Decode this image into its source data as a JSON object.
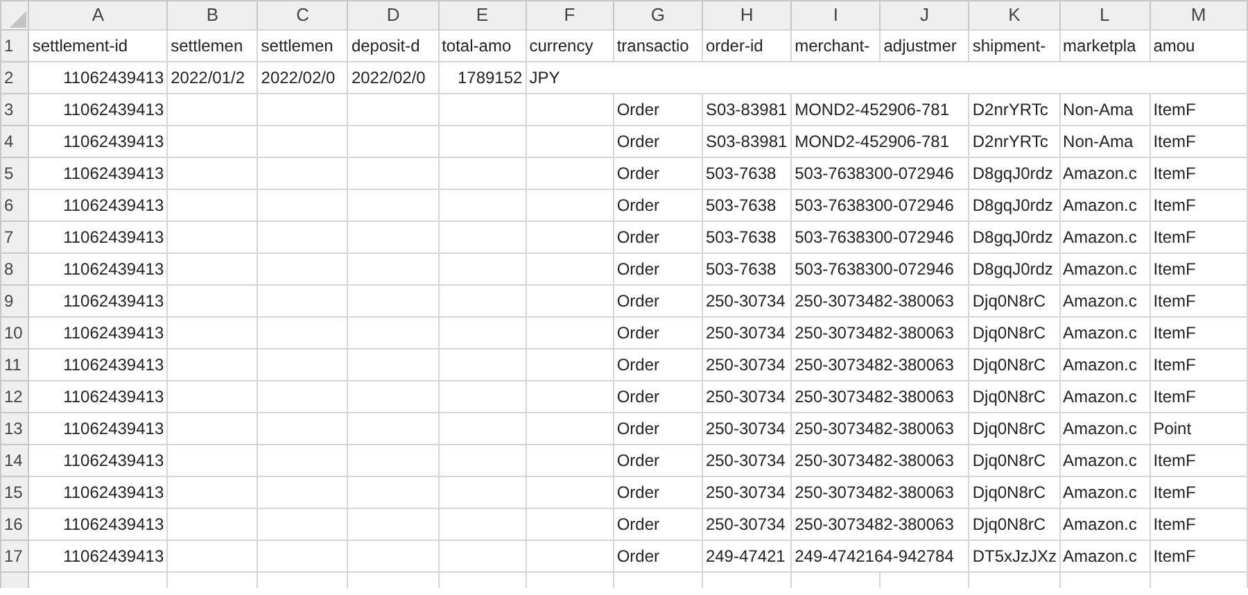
{
  "columns": [
    "A",
    "B",
    "C",
    "D",
    "E",
    "F",
    "G",
    "H",
    "I",
    "J",
    "K",
    "L",
    "M"
  ],
  "rows": [
    {
      "number": "1",
      "cells": [
        "settlement-id",
        "settlemen",
        "settlemen",
        "deposit-d",
        "total-amo",
        "currency",
        "transactio",
        "order-id",
        "merchant-",
        "adjustmer",
        "shipment-",
        "marketpla",
        "amou"
      ]
    },
    {
      "number": "2",
      "cells": [
        {
          "text": "11062439413",
          "kind": "number"
        },
        "2022/01/2",
        "2022/02/0",
        "2022/02/0",
        {
          "text": "1789152",
          "kind": "number"
        },
        "JPY",
        "",
        "",
        "",
        "",
        "",
        "",
        ""
      ]
    },
    {
      "number": "3",
      "cells": [
        {
          "text": "11062439413",
          "kind": "number"
        },
        "",
        "",
        "",
        "",
        "",
        "Order",
        "S03-83981",
        "MOND2-452906-781",
        "",
        "D2nrYRTc",
        "Non-Ama",
        "ItemF"
      ]
    },
    {
      "number": "4",
      "cells": [
        {
          "text": "11062439413",
          "kind": "number"
        },
        "",
        "",
        "",
        "",
        "",
        "Order",
        "S03-83981",
        "MOND2-452906-781",
        "",
        "D2nrYRTc",
        "Non-Ama",
        "ItemF"
      ]
    },
    {
      "number": "5",
      "cells": [
        {
          "text": "11062439413",
          "kind": "number"
        },
        "",
        "",
        "",
        "",
        "",
        "Order",
        "503-7638",
        "503-7638300-072946",
        "",
        "D8gqJ0rdz",
        "Amazon.c",
        "ItemF"
      ]
    },
    {
      "number": "6",
      "cells": [
        {
          "text": "11062439413",
          "kind": "number"
        },
        "",
        "",
        "",
        "",
        "",
        "Order",
        "503-7638",
        "503-7638300-072946",
        "",
        "D8gqJ0rdz",
        "Amazon.c",
        "ItemF"
      ]
    },
    {
      "number": "7",
      "cells": [
        {
          "text": "11062439413",
          "kind": "number"
        },
        "",
        "",
        "",
        "",
        "",
        "Order",
        "503-7638",
        "503-7638300-072946",
        "",
        "D8gqJ0rdz",
        "Amazon.c",
        "ItemF"
      ]
    },
    {
      "number": "8",
      "cells": [
        {
          "text": "11062439413",
          "kind": "number"
        },
        "",
        "",
        "",
        "",
        "",
        "Order",
        "503-7638",
        "503-7638300-072946",
        "",
        "D8gqJ0rdz",
        "Amazon.c",
        "ItemF"
      ]
    },
    {
      "number": "9",
      "cells": [
        {
          "text": "11062439413",
          "kind": "number"
        },
        "",
        "",
        "",
        "",
        "",
        "Order",
        "250-30734",
        "250-3073482-380063",
        "",
        "Djq0N8rC",
        "Amazon.c",
        "ItemF"
      ]
    },
    {
      "number": "10",
      "cells": [
        {
          "text": "11062439413",
          "kind": "number"
        },
        "",
        "",
        "",
        "",
        "",
        "Order",
        "250-30734",
        "250-3073482-380063",
        "",
        "Djq0N8rC",
        "Amazon.c",
        "ItemF"
      ]
    },
    {
      "number": "11",
      "cells": [
        {
          "text": "11062439413",
          "kind": "number"
        },
        "",
        "",
        "",
        "",
        "",
        "Order",
        "250-30734",
        "250-3073482-380063",
        "",
        "Djq0N8rC",
        "Amazon.c",
        "ItemF"
      ]
    },
    {
      "number": "12",
      "cells": [
        {
          "text": "11062439413",
          "kind": "number"
        },
        "",
        "",
        "",
        "",
        "",
        "Order",
        "250-30734",
        "250-3073482-380063",
        "",
        "Djq0N8rC",
        "Amazon.c",
        "ItemF"
      ]
    },
    {
      "number": "13",
      "cells": [
        {
          "text": "11062439413",
          "kind": "number"
        },
        "",
        "",
        "",
        "",
        "",
        "Order",
        "250-30734",
        "250-3073482-380063",
        "",
        "Djq0N8rC",
        "Amazon.c",
        "Point"
      ]
    },
    {
      "number": "14",
      "cells": [
        {
          "text": "11062439413",
          "kind": "number"
        },
        "",
        "",
        "",
        "",
        "",
        "Order",
        "250-30734",
        "250-3073482-380063",
        "",
        "Djq0N8rC",
        "Amazon.c",
        "ItemF"
      ]
    },
    {
      "number": "15",
      "cells": [
        {
          "text": "11062439413",
          "kind": "number"
        },
        "",
        "",
        "",
        "",
        "",
        "Order",
        "250-30734",
        "250-3073482-380063",
        "",
        "Djq0N8rC",
        "Amazon.c",
        "ItemF"
      ]
    },
    {
      "number": "16",
      "cells": [
        {
          "text": "11062439413",
          "kind": "number"
        },
        "",
        "",
        "",
        "",
        "",
        "Order",
        "250-30734",
        "250-3073482-380063",
        "",
        "Djq0N8rC",
        "Amazon.c",
        "ItemF"
      ]
    },
    {
      "number": "17",
      "cells": [
        {
          "text": "11062439413",
          "kind": "number"
        },
        "",
        "",
        "",
        "",
        "",
        "Order",
        "249-47421",
        "249-4742164-942784",
        "",
        "DT5xJzJXz",
        "Amazon.c",
        "ItemF"
      ]
    }
  ]
}
